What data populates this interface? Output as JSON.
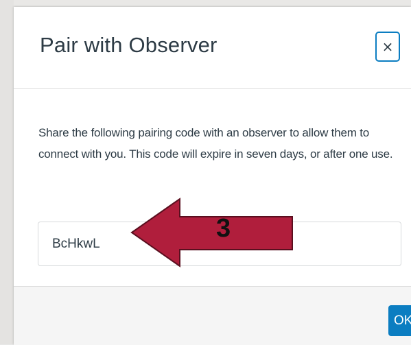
{
  "dialog": {
    "title": "Pair with Observer",
    "close_label": "×",
    "description": "Share the following pairing code with an observer to allow them to connect with you. This code will expire in seven days, or after one use.",
    "pairing_code": "BcHkwL",
    "ok_label": "OK"
  },
  "annotation": {
    "step_number": "3",
    "arrow_color": "#b01e3c",
    "arrow_outline": "#5a0f1f"
  },
  "colors": {
    "accent": "#0b7dc1",
    "text": "#2d3b45"
  }
}
